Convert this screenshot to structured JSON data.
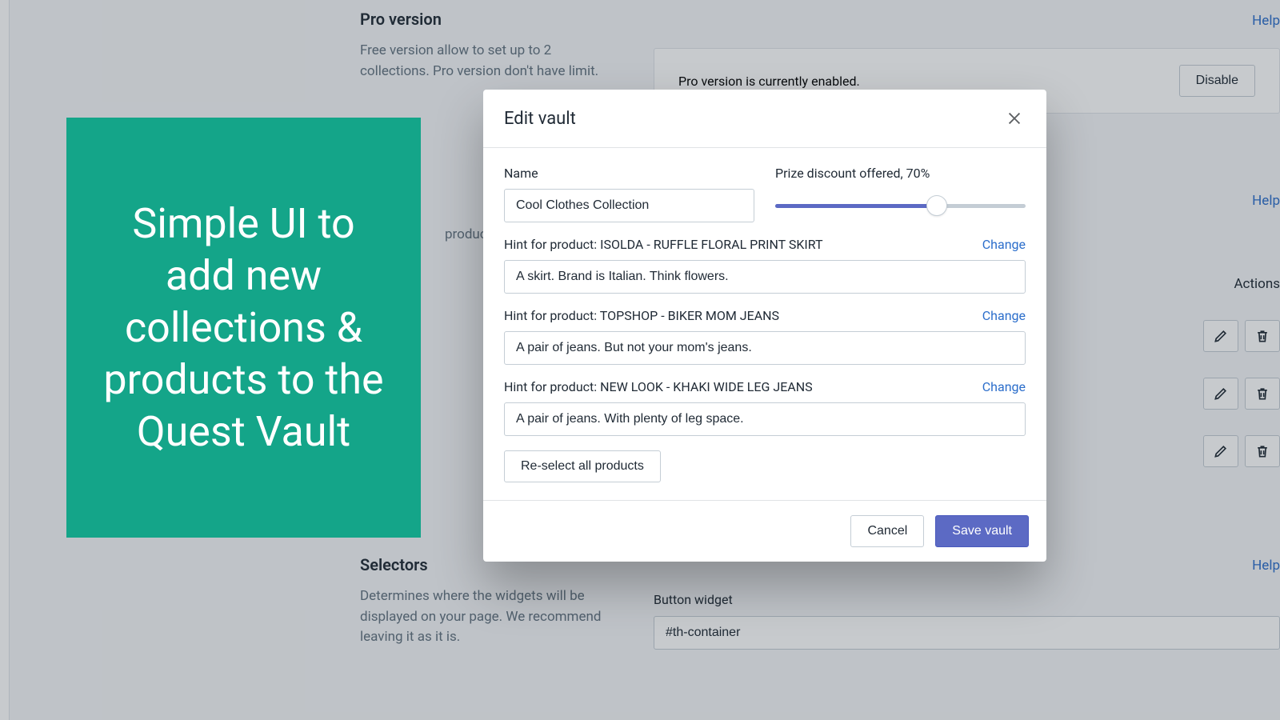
{
  "help_label": "Help",
  "pro_section": {
    "title": "Pro version",
    "desc": "Free version allow to set up to 2 collections. Pro version don't have limit.",
    "status": "Pro version is currently enabled.",
    "disable_btn": "Disable"
  },
  "products_hint": "products for",
  "actions_label": "Actions",
  "selectors_section": {
    "title": "Selectors",
    "desc": "Determines where the widgets will be displayed on your page. We recommend leaving it as it is.",
    "field_label": "Button widget",
    "field_value": "#th-container"
  },
  "callout": "Simple UI to add new collections & products to the Quest Vault",
  "modal": {
    "title": "Edit vault",
    "name_label": "Name",
    "name_value": "Cool Clothes Collection",
    "discount_label": "Prize discount offered, 70%",
    "discount_pct": 70,
    "change_label": "Change",
    "hints": [
      {
        "label": "Hint for product: ISOLDA - RUFFLE FLORAL PRINT SKIRT",
        "value": "A skirt. Brand is Italian. Think flowers."
      },
      {
        "label": "Hint for product: TOPSHOP - BIKER MOM JEANS",
        "value": "A pair of jeans. But not your mom's jeans."
      },
      {
        "label": "Hint for product: NEW LOOK - KHAKI WIDE LEG JEANS",
        "value": "A pair of jeans. With plenty of leg space."
      }
    ],
    "reselect_btn": "Re-select all products",
    "cancel_btn": "Cancel",
    "save_btn": "Save vault"
  }
}
